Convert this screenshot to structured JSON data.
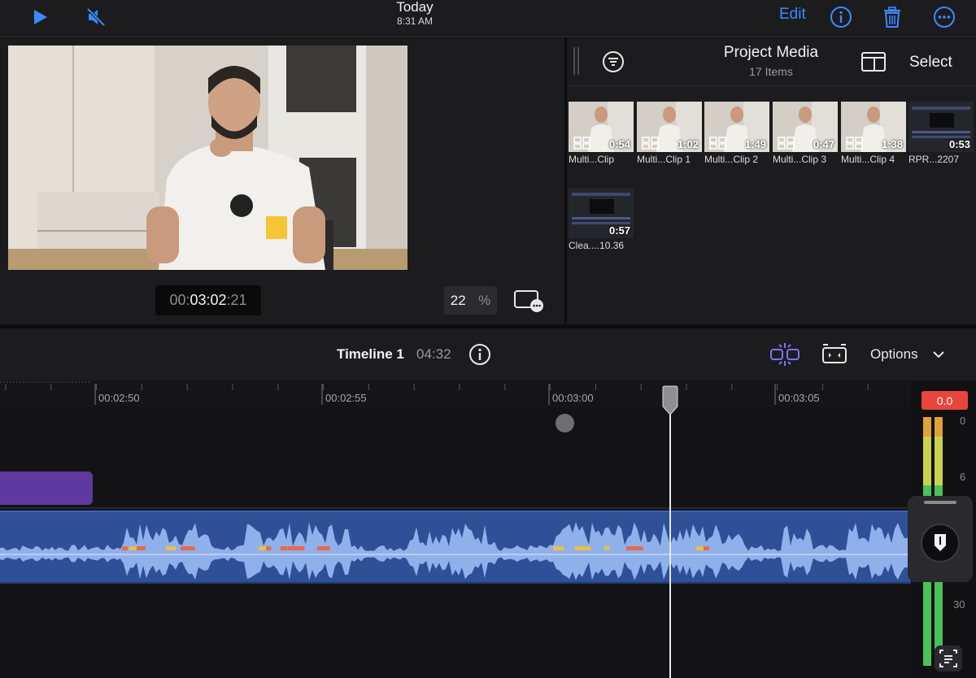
{
  "topbar": {
    "title": "Today",
    "time": "8:31 AM",
    "edit_label": "Edit",
    "icons": [
      "play-icon",
      "mute-icon",
      "info-icon",
      "trash-icon",
      "more-icon"
    ],
    "accent": "#3a8bff"
  },
  "viewer": {
    "timecode_prefix": "00:",
    "timecode_main": "03:02",
    "timecode_frames": ":21",
    "zoom_value": "22",
    "zoom_unit": "%"
  },
  "media": {
    "title": "Project Media",
    "count": "17 Items",
    "select_label": "Select",
    "clips": [
      {
        "duration": "0:54",
        "label": "Multi...Clip",
        "multicam": true
      },
      {
        "duration": "1:02",
        "label": "Multi...Clip 1",
        "multicam": true
      },
      {
        "duration": "1:49",
        "label": "Multi...Clip 2",
        "multicam": true
      },
      {
        "duration": "0:47",
        "label": "Multi...Clip 3",
        "multicam": true
      },
      {
        "duration": "1:38",
        "label": "Multi...Clip 4",
        "multicam": true
      },
      {
        "duration": "0:53",
        "label": "RPR...2207",
        "multicam": false
      },
      {
        "duration": "0:57",
        "label": "Clea....10.36",
        "multicam": false
      }
    ]
  },
  "timeline": {
    "title": "Timeline 1",
    "duration": "04:32",
    "options_label": "Options",
    "ruler_labels": [
      "00:02:50",
      "00:02:55",
      "00:03:00",
      "00:03:05"
    ]
  },
  "meter": {
    "readout": "0.0",
    "labels": [
      "0",
      "6",
      "30"
    ],
    "readout_color": "#e8453c"
  }
}
